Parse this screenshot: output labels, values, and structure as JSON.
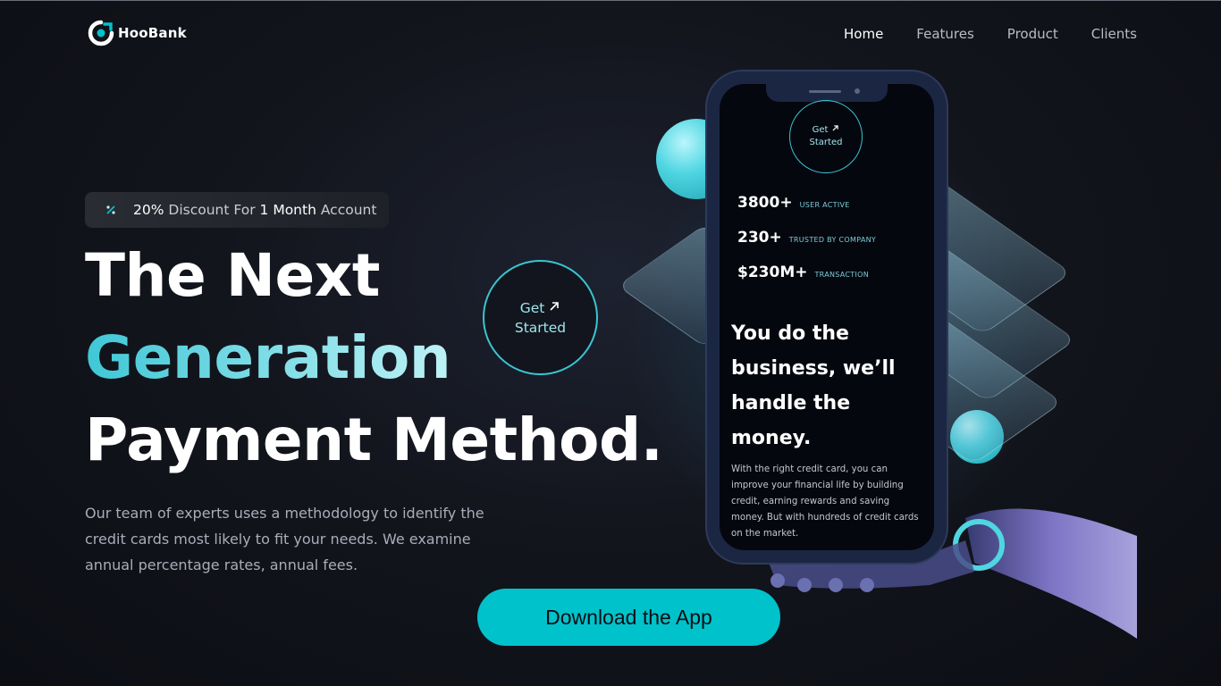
{
  "brand": {
    "name": "HooBank"
  },
  "nav": {
    "items": [
      {
        "label": "Home",
        "active": true
      },
      {
        "label": "Features",
        "active": false
      },
      {
        "label": "Product",
        "active": false
      },
      {
        "label": "Clients",
        "active": false
      }
    ]
  },
  "promo": {
    "pct": "20%",
    "mid1": "Discount For",
    "duration": "1 Month",
    "mid2": "Account"
  },
  "hero": {
    "line1": "The Next",
    "line2": "Generation",
    "line3": "Payment Method.",
    "description": "Our team of experts uses a methodology to identify the credit cards most likely to fit your needs. We examine annual percentage rates, annual fees.",
    "cta_line1": "Get",
    "cta_line2": "Started",
    "download_label": "Download the App"
  },
  "phone": {
    "cta_line1": "Get",
    "cta_line2": "Started",
    "stats": [
      {
        "value": "3800+",
        "label": "USER ACTIVE"
      },
      {
        "value": "230+",
        "label": "TRUSTED BY COMPANY"
      },
      {
        "value": "$230M+",
        "label": "TRANSACTION"
      }
    ],
    "heading": "You do the business, we’ll handle the money.",
    "body": "With the right credit card, you can improve your financial life by building credit, earning rewards and saving money. But with hundreds of credit cards on the market."
  },
  "colors": {
    "accent": "#00c2cb",
    "background": "#0f1118",
    "gradient_start": "#3fc7d6",
    "gradient_end": "#bdf2f6"
  }
}
